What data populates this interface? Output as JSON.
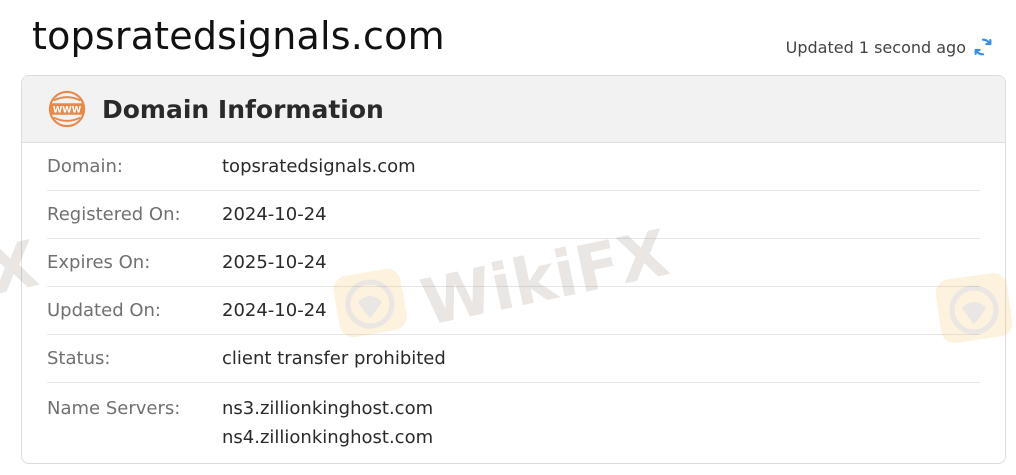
{
  "header": {
    "title": "topsratedsignals.com",
    "updated_text": "Updated 1 second ago",
    "refresh_icon": "refresh-icon"
  },
  "card": {
    "title": "Domain Information",
    "icon": "www-icon",
    "accent_color": "#e8894a",
    "rows": [
      {
        "label": "Domain:",
        "value": "topsratedsignals.com"
      },
      {
        "label": "Registered On:",
        "value": "2024-10-24"
      },
      {
        "label": "Expires On:",
        "value": "2025-10-24"
      },
      {
        "label": "Updated On:",
        "value": "2024-10-24"
      },
      {
        "label": "Status:",
        "value": "client transfer prohibited"
      }
    ],
    "name_servers": {
      "label": "Name Servers:",
      "values": [
        "ns3.zillionkinghost.com",
        "ns4.zillionkinghost.com"
      ]
    }
  },
  "watermark": {
    "text": "WikiFX",
    "text_left_fragment": "X"
  },
  "colors": {
    "refresh_blue": "#3a8ee6",
    "header_bg": "#f2f2f2",
    "border": "#dcdcdc"
  }
}
